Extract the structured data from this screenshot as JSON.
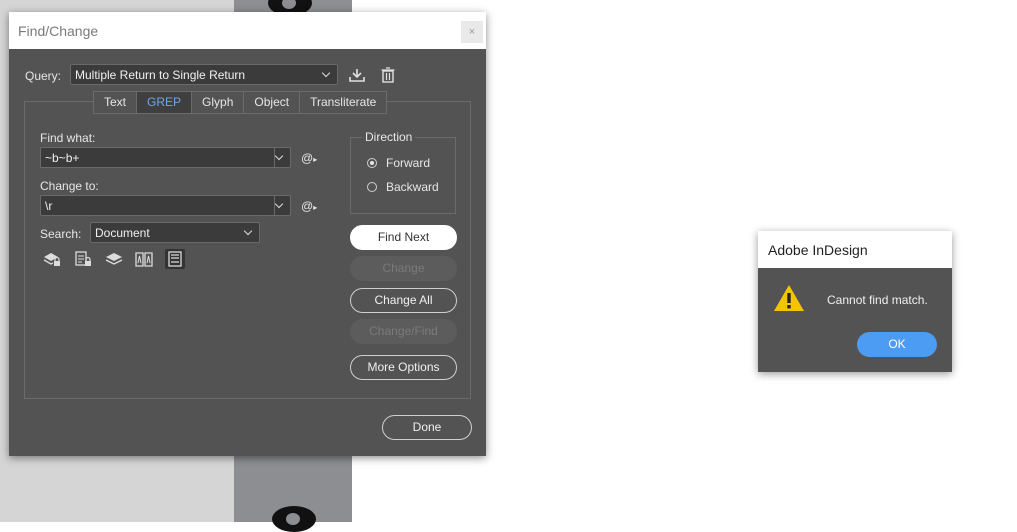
{
  "find_change": {
    "title": "Find/Change",
    "close_glyph": "×",
    "query_label": "Query:",
    "query_value": "Multiple Return to Single Return",
    "tabs": [
      {
        "label": "Text",
        "active": false
      },
      {
        "label": "GREP",
        "active": true
      },
      {
        "label": "Glyph",
        "active": false
      },
      {
        "label": "Object",
        "active": false
      },
      {
        "label": "Transliterate",
        "active": false
      }
    ],
    "find_what_label": "Find what:",
    "find_what_value": "~b~b+",
    "change_to_label": "Change to:",
    "change_to_value": "\\r",
    "special_char_glyph": "@",
    "search_label": "Search:",
    "search_value": "Document",
    "direction": {
      "label": "Direction",
      "forward_label": "Forward",
      "backward_label": "Backward",
      "selected": "Forward"
    },
    "buttons": {
      "find_next": "Find Next",
      "change": "Change",
      "change_all": "Change All",
      "change_find": "Change/Find",
      "more_options": "More Options",
      "done": "Done"
    },
    "icons": {
      "save_query": "save-query-icon",
      "delete_query": "trash-icon",
      "locked_layers": "locked-layers-icon",
      "locked_stories": "locked-stories-icon",
      "hidden_layers": "hidden-layers-icon",
      "master_pages": "master-pages-icon",
      "footnotes": "footnotes-icon"
    }
  },
  "alert": {
    "title": "Adobe InDesign",
    "message": "Cannot find match.",
    "ok_label": "OK",
    "icon": "warning-icon",
    "accent_color": "#4b9cf2",
    "warning_color": "#f5c400"
  }
}
